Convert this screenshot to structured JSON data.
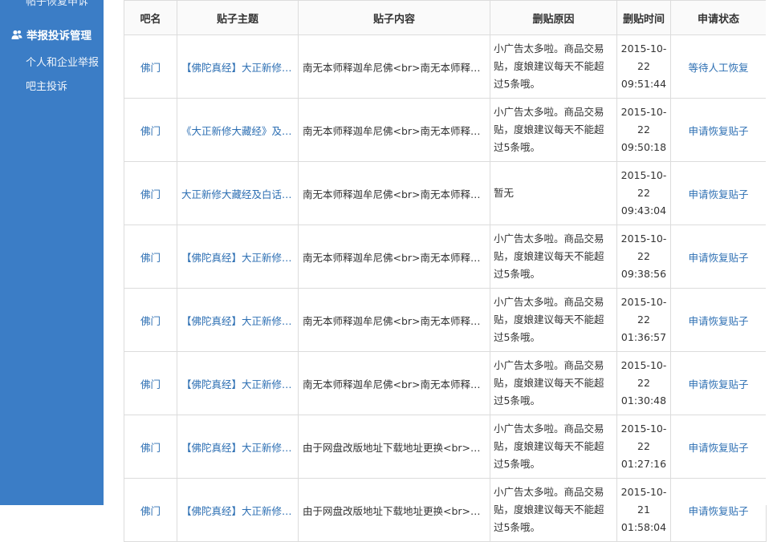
{
  "sidebar": {
    "top_cut_label": "帖子恢复申诉",
    "section_title": "举报投诉管理",
    "items": [
      {
        "label": "个人和企业举报"
      },
      {
        "label": "吧主投诉"
      }
    ]
  },
  "table": {
    "headers": [
      "吧名",
      "贴子主题",
      "贴子内容",
      "删贴原因",
      "删贴时间",
      "申请状态"
    ],
    "rows": [
      {
        "bar": "佛门",
        "subject": "【佛陀真经】大正新修大藏经",
        "content": "南无本师释迦牟尼佛<br>南无本师释迦牟尼佛",
        "reason": "小广告太多啦。商品交易贴，度娘建议每天不能超过5条哦。",
        "date": "2015-10-22",
        "time": "09:51:44",
        "status": "等待人工恢复"
      },
      {
        "bar": "佛门",
        "subject": "《大正新修大藏经》及白话佛经",
        "content": "南无本师释迦牟尼佛<br>南无本师释迦牟尼佛",
        "reason": "小广告太多啦。商品交易贴，度娘建议每天不能超过5条哦。",
        "date": "2015-10-22",
        "time": "09:50:18",
        "status": "申请恢复贴子"
      },
      {
        "bar": "佛门",
        "subject": "大正新修大藏经及白话佛经",
        "content": "南无本师释迦牟尼佛<br>南无本师释迦牟尼佛",
        "reason": "暂无",
        "date": "2015-10-22",
        "time": "09:43:04",
        "status": "申请恢复贴子"
      },
      {
        "bar": "佛门",
        "subject": "【佛陀真经】大正新修大藏经",
        "content": "南无本师释迦牟尼佛<br>南无本师释迦牟尼佛",
        "reason": "小广告太多啦。商品交易贴，度娘建议每天不能超过5条哦。",
        "date": "2015-10-22",
        "time": "09:38:56",
        "status": "申请恢复贴子"
      },
      {
        "bar": "佛门",
        "subject": "【佛陀真经】大正新修大藏经",
        "content": "南无本师释迦牟尼佛<br>南无本师释迦牟尼佛",
        "reason": "小广告太多啦。商品交易贴，度娘建议每天不能超过5条哦。",
        "date": "2015-10-22",
        "time": "01:36:57",
        "status": "申请恢复贴子"
      },
      {
        "bar": "佛门",
        "subject": "【佛陀真经】大正新修大藏经",
        "content": "南无本师释迦牟尼佛<br>南无本师释迦牟尼佛",
        "reason": "小广告太多啦。商品交易贴，度娘建议每天不能超过5条哦。",
        "date": "2015-10-22",
        "time": "01:30:48",
        "status": "申请恢复贴子"
      },
      {
        "bar": "佛门",
        "subject": "【佛陀真经】大正新修大藏经",
        "content": "由于网盘改版地址下载地址更换<br>南无本师释迦牟尼佛",
        "reason": "小广告太多啦。商品交易贴，度娘建议每天不能超过5条哦。",
        "date": "2015-10-22",
        "time": "01:27:16",
        "status": "申请恢复贴子"
      },
      {
        "bar": "佛门",
        "subject": "【佛陀真经】大正新修大藏经",
        "content": "由于网盘改版地址下载地址更换<br>南无本师释迦牟尼佛",
        "reason": "小广告太多啦。商品交易贴，度娘建议每天不能超过5条哦。",
        "date": "2015-10-21",
        "time": "01:58:04",
        "status": "申请恢复贴子"
      }
    ]
  },
  "colors": {
    "sidebar_bg": "#3b7dc6",
    "link": "#2d6fb3",
    "border": "#dcdcdc"
  },
  "icons": {
    "section_icon": "users-icon"
  }
}
